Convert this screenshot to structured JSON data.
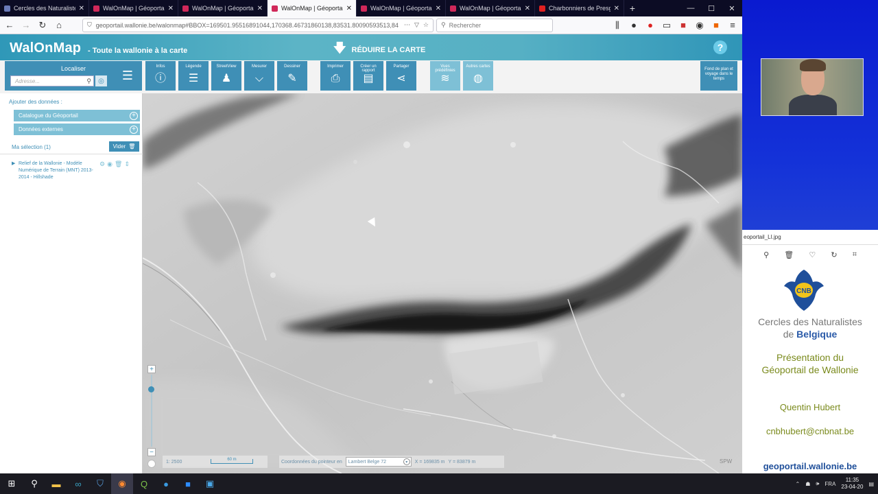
{
  "browser": {
    "tabs": [
      {
        "title": "Cercles des Naturalistes d",
        "favicon_color": "#6a7ab8",
        "active": false
      },
      {
        "title": "WalOnMap | Géoportail d",
        "favicon_color": "#d0285a",
        "active": false
      },
      {
        "title": "WalOnMap | Géoportail d",
        "favicon_color": "#d0285a",
        "active": false
      },
      {
        "title": "WalOnMap | Géoportail d",
        "favicon_color": "#d0285a",
        "active": true
      },
      {
        "title": "WalOnMap | Géoportail d",
        "favicon_color": "#d0285a",
        "active": false
      },
      {
        "title": "WalOnMap | Géoportail d",
        "favicon_color": "#d0285a",
        "active": false
      },
      {
        "title": "Charbonniers de Presgau",
        "favicon_color": "#e02020",
        "active": false
      }
    ],
    "url": "geoportail.wallonie.be/walonmap#BBOX=169501.95516891044,170368.46731860138,83531.80090593513,84",
    "search_placeholder": "Rechercher"
  },
  "app": {
    "logo": "WalOnMap",
    "tagline": "- Toute la wallonie à la carte",
    "reduce_label": "RÉDUIRE LA CARTE",
    "help": "?"
  },
  "toolbar": {
    "localiser_label": "Localiser",
    "address_placeholder": "Adresse...",
    "tools": [
      {
        "label": "Infos",
        "icon": "info-icon",
        "glyph": "ⓘ"
      },
      {
        "label": "Légende",
        "icon": "legend-icon",
        "glyph": "☰"
      },
      {
        "label": "StreetView",
        "icon": "streetview-icon",
        "glyph": "♟"
      },
      {
        "label": "Mesurer",
        "icon": "measure-icon",
        "glyph": "⌵"
      },
      {
        "label": "Dessiner",
        "icon": "draw-icon",
        "glyph": "✎"
      },
      {
        "label": "Imprimer",
        "icon": "print-icon",
        "glyph": "⎙"
      },
      {
        "label": "Créer un rapport",
        "icon": "report-icon",
        "glyph": "▤"
      },
      {
        "label": "Partager",
        "icon": "share-icon",
        "glyph": "⋖"
      },
      {
        "label": "Vues prédéfinies",
        "icon": "layers-icon",
        "glyph": "≋"
      },
      {
        "label": "Autres cartes",
        "icon": "globe-icon",
        "glyph": "◍"
      }
    ],
    "fond_label": "Fond de plan et voyage dans le temps"
  },
  "panel": {
    "title": "Ajouter des données :",
    "catalogue": "Catalogue du Géoportail",
    "externes": "Données externes",
    "selection": "Ma sélection (1)",
    "vider": "Vider",
    "layer_name": "Relief de la Wallonie - Modèle Numérique de Terrain (MNT) 2013-2014 - Hillshade"
  },
  "map": {
    "scale": "1: 2500",
    "scalebar_label": "60 m",
    "coords_label": "Coordonnées du pointeur en",
    "projection": "Lambert Belge 72",
    "x": "X = 169835 m",
    "y": "Y = 83879 m",
    "attribution": "SPW"
  },
  "side": {
    "image_name": "eoportail_LI.jpg",
    "org_line1": "Cercles des Naturalistes",
    "org_de": "de",
    "org_belgique": "Belgique",
    "logo_text": "CNB",
    "pres_line1": "Présentation du",
    "pres_line2": "Géoportail de Wallonie",
    "author": "Quentin Hubert",
    "email": "cnbhubert@cnbnat.be",
    "site": "geoportail.wallonie.be"
  },
  "taskbar": {
    "lang": "FRA",
    "time": "11:35",
    "date": "23-04-20"
  }
}
